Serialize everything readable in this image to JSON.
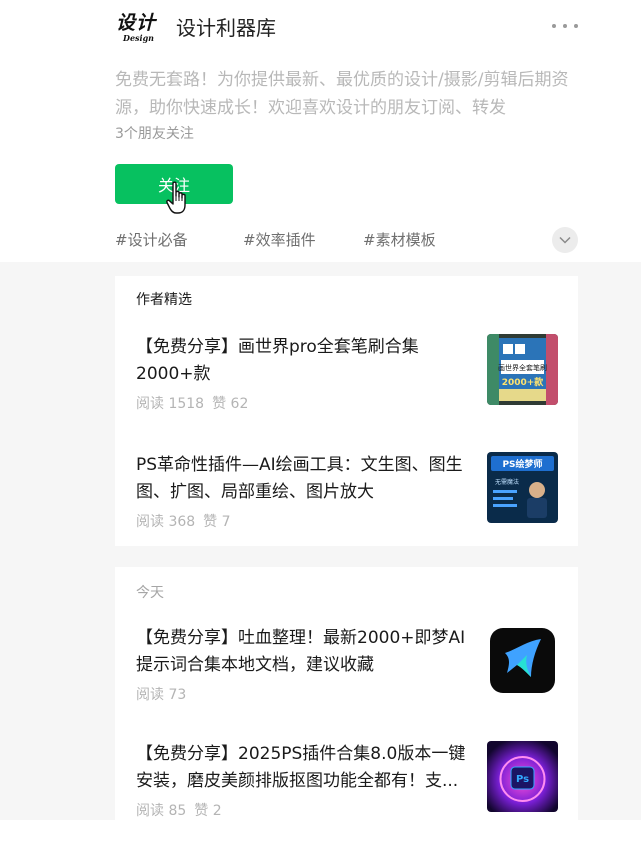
{
  "account": {
    "name": "设计利器库",
    "logo_text_zh": "设计",
    "logo_text_en": "Design",
    "description": "免费无套路！为你提供最新、最优质的设计/摄影/剪辑后期资源，助你快速成长！欢迎喜欢设计的朋友订阅、转发",
    "friends_following": "3个朋友关注",
    "follow_label": "关注"
  },
  "tags": [
    "#设计必备",
    "#效率插件",
    "#素材模板"
  ],
  "featured": {
    "title": "作者精选",
    "articles": [
      {
        "title": "【免费分享】画世界pro全套笔刷合集2000+款",
        "reads": "阅读 1518",
        "likes": "赞 62",
        "thumb_texts": [
          "画世界全套笔刷",
          "2000+款"
        ]
      },
      {
        "title": "PS革命性插件—AI绘画工具：文生图、图生图、扩图、局部重绘、图片放大",
        "reads": "阅读 368",
        "likes": "赞 7",
        "thumb_texts": [
          "PS绘梦师",
          "无需魔法"
        ]
      }
    ]
  },
  "today": {
    "title": "今天",
    "articles": [
      {
        "title": "【免费分享】吐血整理！最新2000+即梦AI提示词合集本地文档，建议收藏",
        "reads": "阅读 73",
        "likes": ""
      },
      {
        "title": "【免费分享】2025PS插件合集8.0版本一键安装，磨皮美颜排版抠图功能全都有！支...",
        "reads": "阅读 85",
        "likes": "赞 2",
        "thumb_texts": [
          "Ps"
        ]
      }
    ]
  },
  "colors": {
    "follow_button": "#07c160",
    "page_background": "#f6f6f6"
  }
}
